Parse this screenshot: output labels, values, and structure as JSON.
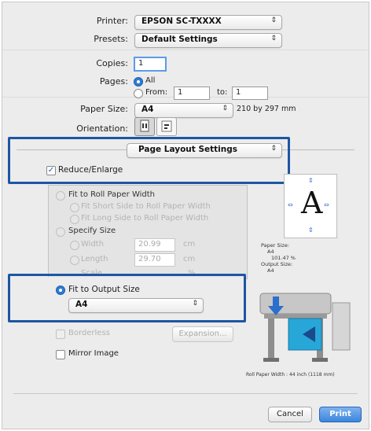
{
  "printer": {
    "label": "Printer:",
    "value": "EPSON SC-TXXXX"
  },
  "presets": {
    "label": "Presets:",
    "value": "Default Settings"
  },
  "copies": {
    "label": "Copies:",
    "value": "1"
  },
  "pages": {
    "label": "Pages:",
    "all": "All",
    "from_label": "From:",
    "from_value": "1",
    "to_label": "to:",
    "to_value": "1"
  },
  "paper_size": {
    "label": "Paper Size:",
    "value": "A4",
    "dims": "210 by 297 mm"
  },
  "orientation": {
    "label": "Orientation:"
  },
  "panel": {
    "value": "Page Layout Settings"
  },
  "reduce_enlarge": {
    "label": "Reduce/Enlarge",
    "checked": true
  },
  "fit_roll": {
    "label": "Fit to Roll Paper Width",
    "short": "Fit Short Side to Roll Paper Width",
    "long": "Fit Long Side to Roll Paper Width"
  },
  "specify": {
    "label": "Specify Size",
    "width_label": "Width",
    "width_value": "20.99",
    "width_unit": "cm",
    "length_label": "Length",
    "length_value": "29.70",
    "length_unit": "cm",
    "scale_label": "Scale",
    "scale_unit": "%"
  },
  "fit_output": {
    "label": "Fit to Output Size",
    "value": "A4"
  },
  "preview": {
    "glyph": "A",
    "paper_size_label": "Paper Size:",
    "paper_size_value": "A4",
    "scale": "101.47 %",
    "output_size_label": "Output Size:",
    "output_size_value": "A4",
    "roll_width": "Roll Paper Width : 44 inch (1118 mm)"
  },
  "borderless": {
    "label": "Borderless"
  },
  "expansion": {
    "label": "Expansion..."
  },
  "mirror": {
    "label": "Mirror Image"
  },
  "buttons": {
    "cancel": "Cancel",
    "print": "Print"
  },
  "colors": {
    "highlight": "#1d56a3",
    "accent": "#2d7bd6"
  }
}
